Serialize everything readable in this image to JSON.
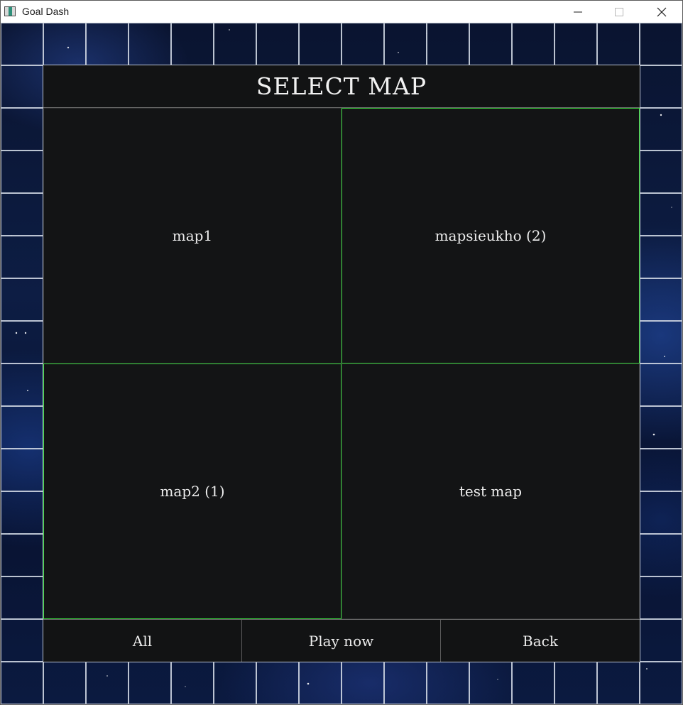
{
  "window": {
    "title": "Goal Dash",
    "icon": "app-icon"
  },
  "controls": {
    "minimize_icon": "minimize-icon",
    "maximize_icon": "maximize-icon",
    "close_icon": "close-icon"
  },
  "screen": {
    "title": "SELECT MAP"
  },
  "maps": [
    {
      "label": "map1",
      "selected": false
    },
    {
      "label": "mapsieukho (2)",
      "selected": true
    },
    {
      "label": "map2 (1)",
      "selected": true
    },
    {
      "label": "test map",
      "selected": false
    }
  ],
  "footer": {
    "all_label": "All",
    "play_label": "Play now",
    "back_label": "Back"
  },
  "colors": {
    "selection_border": "#36d33a",
    "panel_background": "#121314",
    "text": "#ececec"
  }
}
